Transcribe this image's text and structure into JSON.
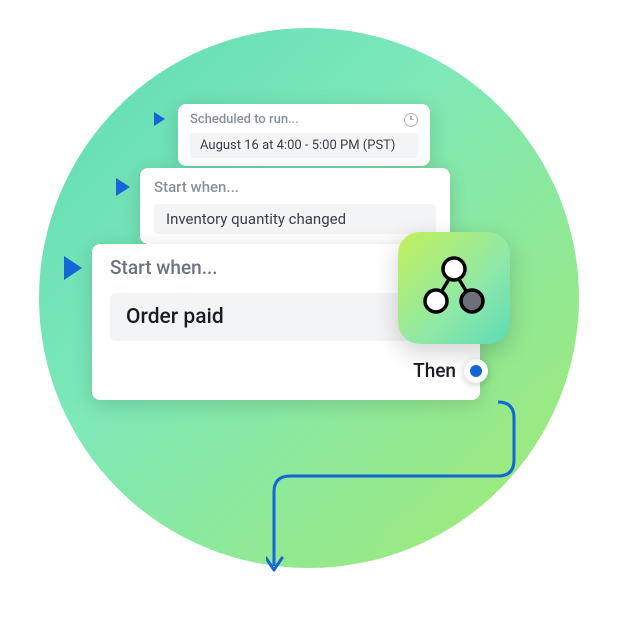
{
  "cards": {
    "scheduled": {
      "title": "Scheduled to run...",
      "content": "August 16 at 4:00 - 5:00 PM (PST)"
    },
    "inventory": {
      "title": "Start when...",
      "content": "Inventory quantity changed"
    },
    "order": {
      "title": "Start when...",
      "content": "Order paid",
      "then": "Then"
    }
  }
}
